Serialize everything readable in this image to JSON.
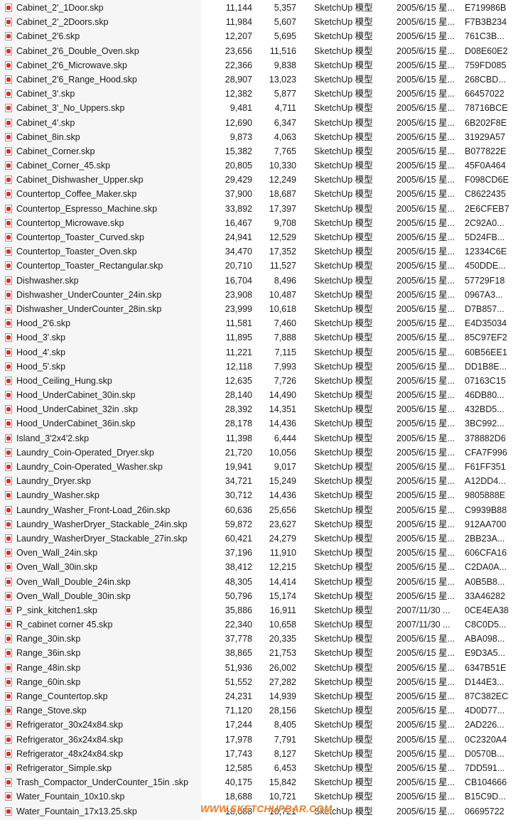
{
  "file_type": "SketchUp 模型",
  "watermark": "WWW.SKETCHUPBAR.COM",
  "files": [
    [
      "Cabinet_2'_1Door.skp",
      "11,144",
      "5,357",
      "2005/6/15 星...",
      "E719986B"
    ],
    [
      "Cabinet_2'_2Doors.skp",
      "11,984",
      "5,607",
      "2005/6/15 星...",
      "F7B3B234"
    ],
    [
      "Cabinet_2'6.skp",
      "12,207",
      "5,695",
      "2005/6/15 星...",
      "761C3B..."
    ],
    [
      "Cabinet_2'6_Double_Oven.skp",
      "23,656",
      "11,516",
      "2005/6/15 星...",
      "D08E60E2"
    ],
    [
      "Cabinet_2'6_Microwave.skp",
      "22,366",
      "9,838",
      "2005/6/15 星...",
      "759FD085"
    ],
    [
      "Cabinet_2'6_Range_Hood.skp",
      "28,907",
      "13,023",
      "2005/6/15 星...",
      "268CBD..."
    ],
    [
      "Cabinet_3'.skp",
      "12,382",
      "5,877",
      "2005/6/15 星...",
      "66457022"
    ],
    [
      "Cabinet_3'_No_Uppers.skp",
      "9,481",
      "4,711",
      "2005/6/15 星...",
      "78716BCE"
    ],
    [
      "Cabinet_4'.skp",
      "12,690",
      "6,347",
      "2005/6/15 星...",
      "6B202F8E"
    ],
    [
      "Cabinet_8in.skp",
      "9,873",
      "4,063",
      "2005/6/15 星...",
      "31929A57"
    ],
    [
      "Cabinet_Corner.skp",
      "15,382",
      "7,765",
      "2005/6/15 星...",
      "B077822E"
    ],
    [
      "Cabinet_Corner_45.skp",
      "20,805",
      "10,330",
      "2005/6/15 星...",
      "45F0A464"
    ],
    [
      "Cabinet_Dishwasher_Upper.skp",
      "29,429",
      "12,249",
      "2005/6/15 星...",
      "F098CD6E"
    ],
    [
      "Countertop_Coffee_Maker.skp",
      "37,900",
      "18,687",
      "2005/6/15 星...",
      "C8622435"
    ],
    [
      "Countertop_Espresso_Machine.skp",
      "33,892",
      "17,397",
      "2005/6/15 星...",
      "2E6CFEB7"
    ],
    [
      "Countertop_Microwave.skp",
      "16,467",
      "9,708",
      "2005/6/15 星...",
      "2C92A0..."
    ],
    [
      "Countertop_Toaster_Curved.skp",
      "24,941",
      "12,529",
      "2005/6/15 星...",
      "5D24FB..."
    ],
    [
      "Countertop_Toaster_Oven.skp",
      "34,470",
      "17,352",
      "2005/6/15 星...",
      "12334C6E"
    ],
    [
      "Countertop_Toaster_Rectangular.skp",
      "20,710",
      "11,527",
      "2005/6/15 星...",
      "450DDE..."
    ],
    [
      "Dishwasher.skp",
      "16,704",
      "8,496",
      "2005/6/15 星...",
      "57729F18"
    ],
    [
      "Dishwasher_UnderCounter_24in.skp",
      "23,908",
      "10,487",
      "2005/6/15 星...",
      "0967A3..."
    ],
    [
      "Dishwasher_UnderCounter_28in.skp",
      "23,999",
      "10,618",
      "2005/6/15 星...",
      "D7B857..."
    ],
    [
      "Hood_2'6.skp",
      "11,581",
      "7,460",
      "2005/6/15 星...",
      "E4D35034"
    ],
    [
      "Hood_3'.skp",
      "11,895",
      "7,888",
      "2005/6/15 星...",
      "85C97EF2"
    ],
    [
      "Hood_4'.skp",
      "11,221",
      "7,115",
      "2005/6/15 星...",
      "60B56EE1"
    ],
    [
      "Hood_5'.skp",
      "12,118",
      "7,993",
      "2005/6/15 星...",
      "DD1B8E..."
    ],
    [
      "Hood_Ceiling_Hung.skp",
      "12,635",
      "7,726",
      "2005/6/15 星...",
      "07163C15"
    ],
    [
      "Hood_UnderCabinet_30in.skp",
      "28,140",
      "14,490",
      "2005/6/15 星...",
      "46DB80..."
    ],
    [
      "Hood_UnderCabinet_32in .skp",
      "28,392",
      "14,351",
      "2005/6/15 星...",
      "432BD5..."
    ],
    [
      "Hood_UnderCabinet_36in.skp",
      "28,178",
      "14,436",
      "2005/6/15 星...",
      "3BC992..."
    ],
    [
      "Island_3'2x4'2.skp",
      "11,398",
      "6,444",
      "2005/6/15 星...",
      "378882D6"
    ],
    [
      "Laundry_Coin-Operated_Dryer.skp",
      "21,720",
      "10,056",
      "2005/6/15 星...",
      "CFA7F996"
    ],
    [
      "Laundry_Coin-Operated_Washer.skp",
      "19,941",
      "9,017",
      "2005/6/15 星...",
      "F61FF351"
    ],
    [
      "Laundry_Dryer.skp",
      "34,721",
      "15,249",
      "2005/6/15 星...",
      "A12DD4..."
    ],
    [
      "Laundry_Washer.skp",
      "30,712",
      "14,436",
      "2005/6/15 星...",
      "9805888E"
    ],
    [
      "Laundry_Washer_Front-Load_26in.skp",
      "60,636",
      "25,656",
      "2005/6/15 星...",
      "C9939B88"
    ],
    [
      "Laundry_WasherDryer_Stackable_24in.skp",
      "59,872",
      "23,627",
      "2005/6/15 星...",
      "912AA700"
    ],
    [
      "Laundry_WasherDryer_Stackable_27in.skp",
      "60,421",
      "24,279",
      "2005/6/15 星...",
      "2BB23A..."
    ],
    [
      "Oven_Wall_24in.skp",
      "37,196",
      "11,910",
      "2005/6/15 星...",
      "606CFA16"
    ],
    [
      "Oven_Wall_30in.skp",
      "38,412",
      "12,215",
      "2005/6/15 星...",
      "C2DA0A..."
    ],
    [
      "Oven_Wall_Double_24in.skp",
      "48,305",
      "14,414",
      "2005/6/15 星...",
      "A0B5B8..."
    ],
    [
      "Oven_Wall_Double_30in.skp",
      "50,796",
      "15,174",
      "2005/6/15 星...",
      "33A46282"
    ],
    [
      "P_sink_kitchen1.skp",
      "35,886",
      "16,911",
      "2007/11/30 ...",
      "0CE4EA38"
    ],
    [
      "R_cabinet corner 45.skp",
      "22,340",
      "10,658",
      "2007/11/30 ...",
      "C8C0D5..."
    ],
    [
      "Range_30in.skp",
      "37,778",
      "20,335",
      "2005/6/15 星...",
      "ABA098..."
    ],
    [
      "Range_36in.skp",
      "38,865",
      "21,753",
      "2005/6/15 星...",
      "E9D3A5..."
    ],
    [
      "Range_48in.skp",
      "51,936",
      "26,002",
      "2005/6/15 星...",
      "6347B51E"
    ],
    [
      "Range_60in.skp",
      "51,552",
      "27,282",
      "2005/6/15 星...",
      "D144E3..."
    ],
    [
      "Range_Countertop.skp",
      "24,231",
      "14,939",
      "2005/6/15 星...",
      "87C382EC"
    ],
    [
      "Range_Stove.skp",
      "71,120",
      "28,156",
      "2005/6/15 星...",
      "4D0D77..."
    ],
    [
      "Refrigerator_30x24x84.skp",
      "17,244",
      "8,405",
      "2005/6/15 星...",
      "2AD226..."
    ],
    [
      "Refrigerator_36x24x84.skp",
      "17,978",
      "7,791",
      "2005/6/15 星...",
      "0C2320A4"
    ],
    [
      "Refrigerator_48x24x84.skp",
      "17,743",
      "8,127",
      "2005/6/15 星...",
      "D0570B..."
    ],
    [
      "Refrigerator_Simple.skp",
      "12,585",
      "6,453",
      "2005/6/15 星...",
      "7DD591..."
    ],
    [
      "Trash_Compactor_UnderCounter_15in .skp",
      "40,175",
      "15,842",
      "2005/6/15 星...",
      "CB104666"
    ],
    [
      "Water_Fountain_10x10.skp",
      "18,688",
      "10,721",
      "2005/6/15 星...",
      "B15C9D..."
    ],
    [
      "Water_Fountain_17x13.25.skp",
      "18,688",
      "10,721",
      "2005/6/15 星...",
      "06695722"
    ]
  ]
}
